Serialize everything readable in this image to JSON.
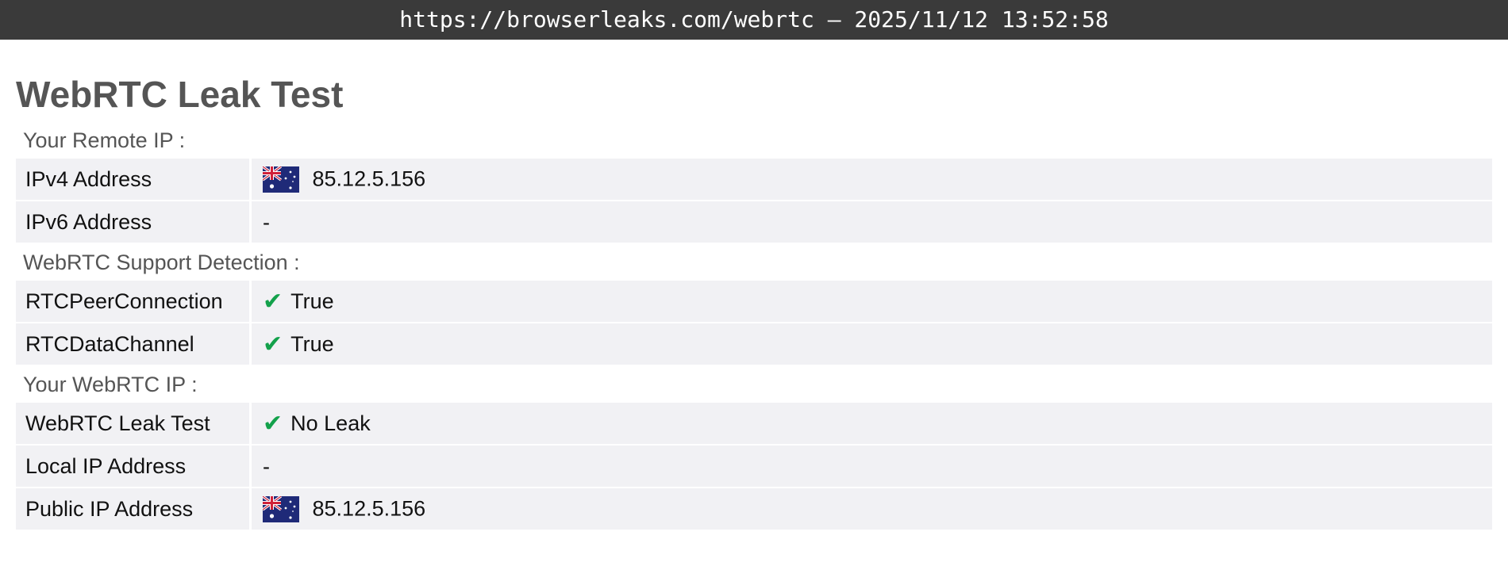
{
  "topbar": {
    "url_timestamp": "https://browserleaks.com/webrtc – 2025/11/12 13:52:58"
  },
  "page": {
    "title": "WebRTC Leak Test"
  },
  "sections": {
    "remote_ip": {
      "label": "Your Remote IP :",
      "rows": {
        "ipv4": {
          "key": "IPv4 Address",
          "value": "85.12.5.156",
          "flag": "australia-flag-icon"
        },
        "ipv6": {
          "key": "IPv6 Address",
          "value": "-"
        }
      }
    },
    "support": {
      "label": "WebRTC Support Detection :",
      "rows": {
        "peer": {
          "key": "RTCPeerConnection",
          "value": "True",
          "icon": "check-icon"
        },
        "channel": {
          "key": "RTCDataChannel",
          "value": "True",
          "icon": "check-icon"
        }
      }
    },
    "webrtc_ip": {
      "label": "Your WebRTC IP :",
      "rows": {
        "leak": {
          "key": "WebRTC Leak Test",
          "value": "No Leak",
          "icon": "check-icon"
        },
        "local": {
          "key": "Local IP Address",
          "value": "-"
        },
        "public": {
          "key": "Public IP Address",
          "value": "85.12.5.156",
          "flag": "australia-flag-icon"
        }
      }
    }
  },
  "colors": {
    "topbar_bg": "#3a3a3a",
    "row_bg": "#f1f1f4",
    "check": "#13a14b",
    "heading": "#555555"
  }
}
